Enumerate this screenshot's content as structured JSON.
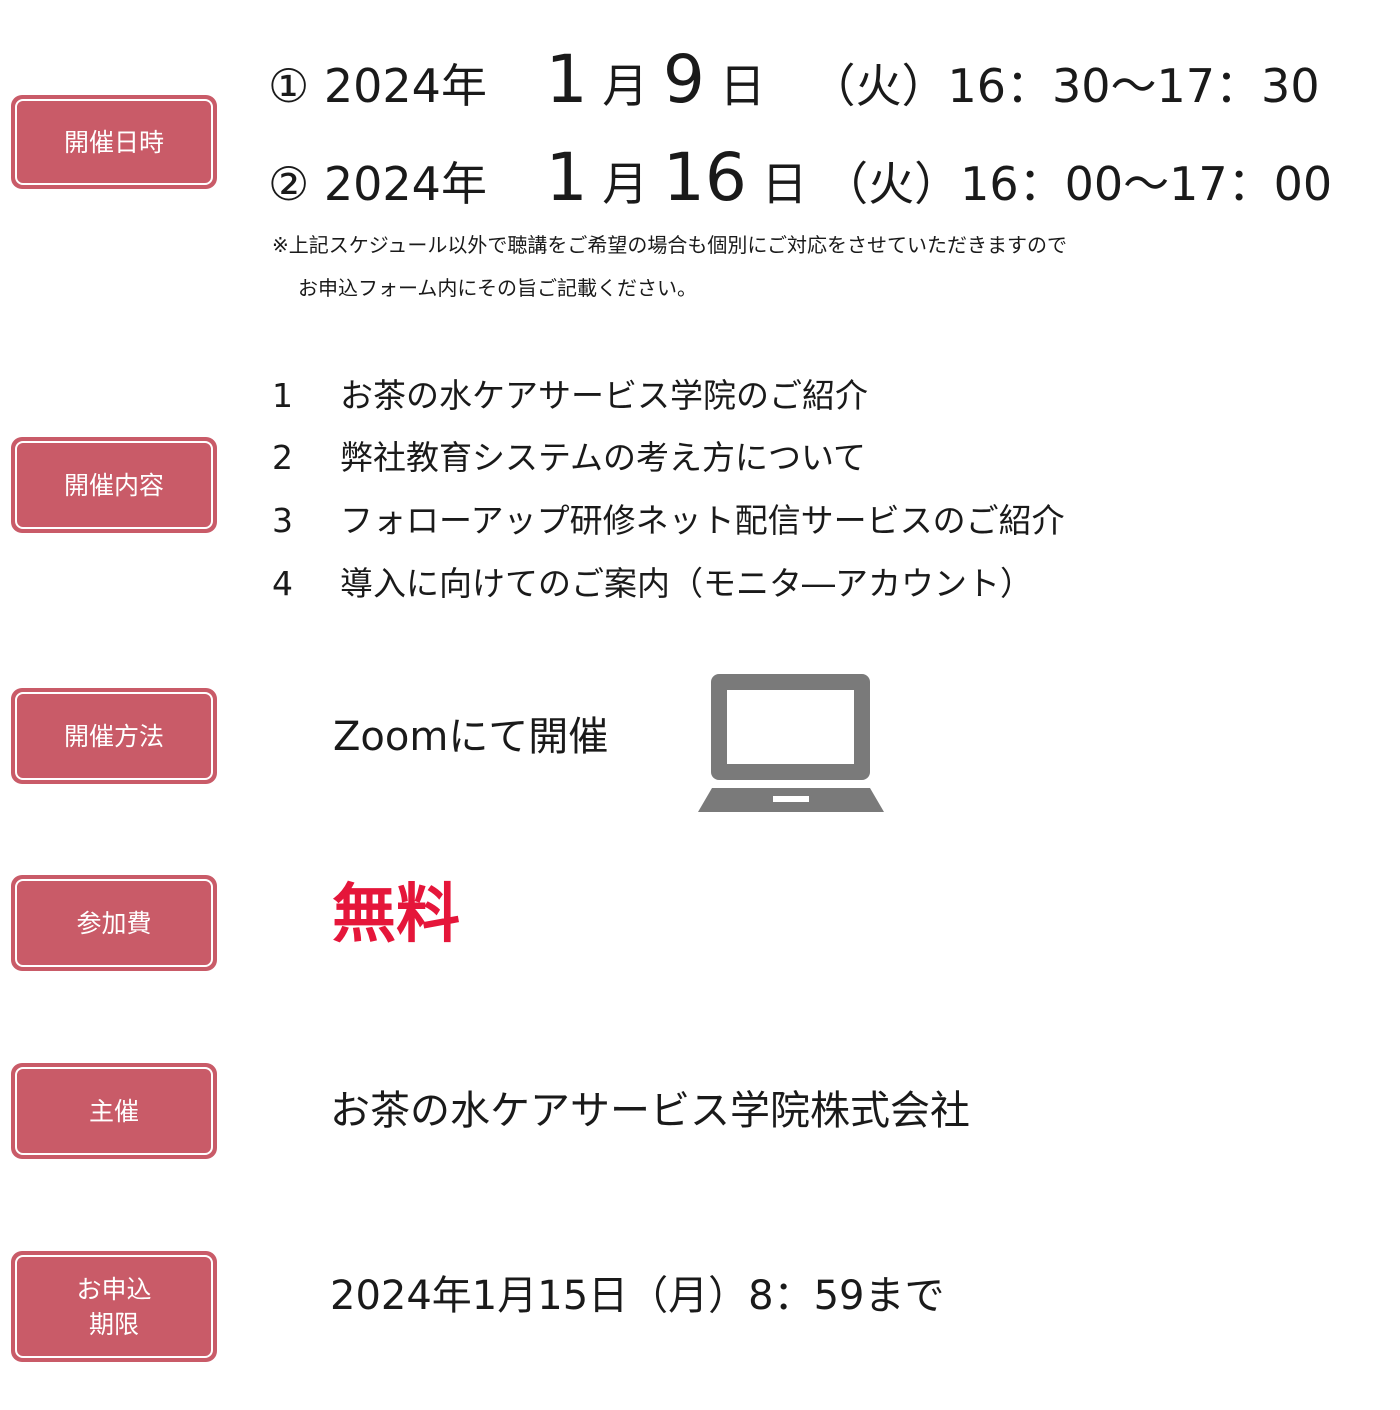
{
  "labels": {
    "datetime": "開催日時",
    "content": "開催内容",
    "method": "開催方法",
    "fee": "参加費",
    "organizer": "主催",
    "deadline_line1": "お申込",
    "deadline_line2": "期限"
  },
  "schedule": [
    {
      "marker": "①",
      "year": "2024年",
      "month": "1",
      "month_unit": "月",
      "day": "9",
      "day_unit": "日",
      "time": "（火）16：30〜17：30"
    },
    {
      "marker": "②",
      "year": "2024年",
      "month": "1",
      "month_unit": "月",
      "day": "16",
      "day_unit": "日",
      "time": "（火）16：00〜17：00"
    }
  ],
  "note": {
    "line1": "※上記スケジュール以外で聴講をご希望の場合も個別にご対応をさせていただきますので",
    "line2": "お申込フォーム内にその旨ご記載ください。"
  },
  "agenda": [
    {
      "num": "1",
      "text": "お茶の水ケアサービス学院のご紹介"
    },
    {
      "num": "2",
      "text": "弊社教育システムの考え方について"
    },
    {
      "num": "3",
      "text": "フォローアップ研修ネット配信サービスのご紹介"
    },
    {
      "num": "4",
      "text": "導入に向けてのご案内（モニタ―アカウント）"
    }
  ],
  "method": {
    "text": "Zoomにて開催",
    "icon": "laptop-icon"
  },
  "fee": {
    "text": "無料",
    "color": "#e5163a"
  },
  "organizer": {
    "text": "お茶の水ケアサービス学院株式会社"
  },
  "deadline": {
    "text": "2024年1月15日（月）8：59まで"
  },
  "colors": {
    "label_bg": "#c95b68",
    "label_text": "#ffffff",
    "icon_gray": "#7a7a7a"
  }
}
